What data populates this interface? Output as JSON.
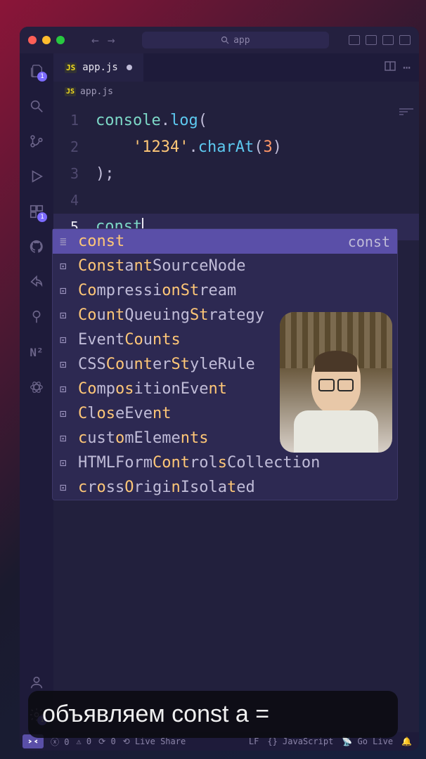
{
  "titlebar": {
    "search_placeholder": "app"
  },
  "tabs": {
    "active": {
      "icon": "JS",
      "label": "app.js"
    }
  },
  "breadcrumbs": {
    "icon": "JS",
    "path": "app.js"
  },
  "activity": {
    "explorer_badge": "1",
    "scm_badge": "1",
    "settings_badge": "1"
  },
  "editor": {
    "lines": [
      {
        "num": "1",
        "tokens": [
          [
            "obj",
            "console"
          ],
          [
            "punct",
            "."
          ],
          [
            "method",
            "log"
          ],
          [
            "punct",
            "("
          ]
        ]
      },
      {
        "num": "2",
        "tokens": [
          [
            "plain",
            "    "
          ],
          [
            "str",
            "'1234'"
          ],
          [
            "punct",
            "."
          ],
          [
            "method",
            "charAt"
          ],
          [
            "punct",
            "("
          ],
          [
            "num",
            "3"
          ],
          [
            "punct",
            ")"
          ]
        ]
      },
      {
        "num": "3",
        "tokens": [
          [
            "punct",
            ");"
          ]
        ]
      },
      {
        "num": "4",
        "tokens": []
      },
      {
        "num": "5",
        "tokens": [
          [
            "kw",
            "const"
          ]
        ],
        "active": true,
        "cursor": true
      }
    ]
  },
  "autocomplete": {
    "hint": "const",
    "items": [
      {
        "icon": "≣",
        "text": "const",
        "selected": true,
        "segs": [
          [
            "hl",
            "const"
          ]
        ]
      },
      {
        "icon": "⊡",
        "segs": [
          [
            "hl",
            "Const"
          ],
          [
            "plain",
            "a"
          ],
          [
            "hl",
            "nt"
          ],
          [
            "plain",
            "SourceNode"
          ]
        ]
      },
      {
        "icon": "⊡",
        "segs": [
          [
            "hl",
            "Co"
          ],
          [
            "plain",
            "mpressi"
          ],
          [
            "hl",
            "onSt"
          ],
          [
            "plain",
            "ream"
          ]
        ]
      },
      {
        "icon": "⊡",
        "segs": [
          [
            "hl",
            "Co"
          ],
          [
            "plain",
            "u"
          ],
          [
            "hl",
            "nt"
          ],
          [
            "plain",
            "Queuing"
          ],
          [
            "hl",
            "St"
          ],
          [
            "plain",
            "rategy"
          ]
        ]
      },
      {
        "icon": "⊡",
        "segs": [
          [
            "plain",
            "Event"
          ],
          [
            "hl",
            "Co"
          ],
          [
            "plain",
            "u"
          ],
          [
            "hl",
            "nts"
          ]
        ]
      },
      {
        "icon": "⊡",
        "segs": [
          [
            "plain",
            "CSS"
          ],
          [
            "hl",
            "Co"
          ],
          [
            "plain",
            "u"
          ],
          [
            "hl",
            "nt"
          ],
          [
            "plain",
            "er"
          ],
          [
            "hl",
            "St"
          ],
          [
            "plain",
            "yleRule"
          ]
        ]
      },
      {
        "icon": "⊡",
        "segs": [
          [
            "hl",
            "Co"
          ],
          [
            "plain",
            "mp"
          ],
          [
            "hl",
            "os"
          ],
          [
            "plain",
            "itionEve"
          ],
          [
            "hl",
            "nt"
          ]
        ]
      },
      {
        "icon": "⊡",
        "segs": [
          [
            "hl",
            "C"
          ],
          [
            "plain",
            "l"
          ],
          [
            "hl",
            "os"
          ],
          [
            "plain",
            "eEve"
          ],
          [
            "hl",
            "nt"
          ]
        ]
      },
      {
        "icon": "⊡",
        "segs": [
          [
            "hl",
            "c"
          ],
          [
            "plain",
            "ust"
          ],
          [
            "hl",
            "o"
          ],
          [
            "plain",
            "mEleme"
          ],
          [
            "hl",
            "nts"
          ]
        ]
      },
      {
        "icon": "⊡",
        "segs": [
          [
            "plain",
            "HTMLForm"
          ],
          [
            "hl",
            "Cont"
          ],
          [
            "plain",
            "rol"
          ],
          [
            "hl",
            "s"
          ],
          [
            "plain",
            "Collection"
          ]
        ]
      },
      {
        "icon": "⊡",
        "segs": [
          [
            "hl",
            "c"
          ],
          [
            "plain",
            "r"
          ],
          [
            "hl",
            "o"
          ],
          [
            "plain",
            "ss"
          ],
          [
            "hl",
            "O"
          ],
          [
            "plain",
            "rigi"
          ],
          [
            "hl",
            "n"
          ],
          [
            "plain",
            "Isola"
          ],
          [
            "hl",
            "t"
          ],
          [
            "plain",
            "ed"
          ]
        ]
      }
    ]
  },
  "caption": "объявляем const a =",
  "statusbar": {
    "errors": "0",
    "warnings": "0",
    "port": "0",
    "liveshare": "Live Share",
    "lf": "LF",
    "lang": "JavaScript",
    "golive": "Go Live"
  }
}
